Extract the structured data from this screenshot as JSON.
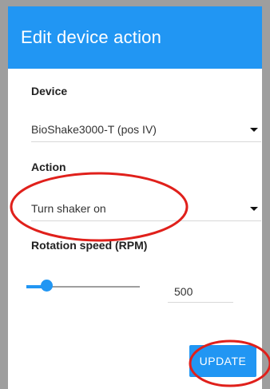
{
  "dialog": {
    "title": "Edit device action"
  },
  "device": {
    "label": "Device",
    "value": "BioShake3000-T (pos IV)"
  },
  "action": {
    "label": "Action",
    "value": "Turn shaker on"
  },
  "rotation": {
    "label": "Rotation speed (RPM)",
    "value": "500"
  },
  "buttons": {
    "update_label": "UPDATE"
  },
  "colors": {
    "primary": "#2196f3",
    "annotation": "#e0201b",
    "frame": "#9e9e9e"
  },
  "icons": {
    "dropdown": "chevron-down-icon"
  }
}
